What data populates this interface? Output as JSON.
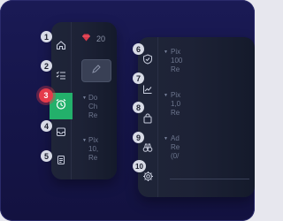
{
  "left_panel": {
    "gem_value": "20",
    "list": [
      {
        "lines": "Do\nCh\nRe"
      },
      {
        "lines": "Pix\n10,\nRe"
      }
    ]
  },
  "right_panel": {
    "list": [
      {
        "lines": "Pix\n100\nRe"
      },
      {
        "lines": "Pix\n1,0\nRe"
      },
      {
        "lines": "Ad\nRe\n(0/"
      }
    ]
  },
  "badges": [
    "1",
    "2",
    "3",
    "4",
    "5",
    "6",
    "7",
    "8",
    "9",
    "10"
  ],
  "rail_left_icons": [
    "home-icon",
    "checklist-icon",
    "alarm-clock-icon",
    "inbox-icon",
    "document-icon"
  ],
  "rail_right_icons": [
    "shield-icon",
    "chart-up-icon",
    "shopping-bag-icon",
    "binoculars-icon",
    "gear-icon"
  ],
  "colors": {
    "active": "#23b06b",
    "highlight_badge": "#e53b4b",
    "gem": "#d8394a"
  }
}
